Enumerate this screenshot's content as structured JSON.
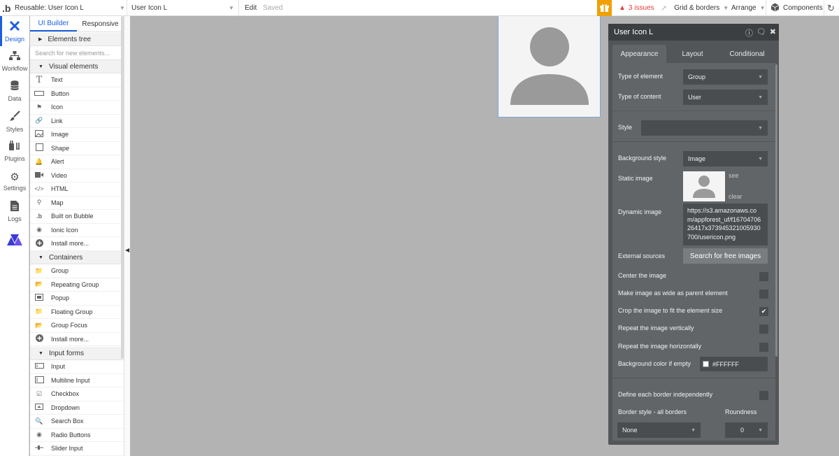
{
  "topbar": {
    "logo": ".b",
    "page_dropdown": "Reusable: User Icon L",
    "element_dropdown": "User Icon L",
    "edit_label": "Edit",
    "saved_label": "Saved",
    "issues_label": "3 issues",
    "grid_label": "Grid & borders",
    "arrange_label": "Arrange",
    "components_label": "Components"
  },
  "rail": {
    "items": [
      {
        "label": "Design",
        "icon": "design-icon"
      },
      {
        "label": "Workflow",
        "icon": "workflow-icon"
      },
      {
        "label": "Data",
        "icon": "database-icon"
      },
      {
        "label": "Styles",
        "icon": "brush-icon"
      },
      {
        "label": "Plugins",
        "icon": "plug-icon"
      },
      {
        "label": "Settings",
        "icon": "gear-icon"
      },
      {
        "label": "Logs",
        "icon": "document-icon"
      }
    ]
  },
  "builder": {
    "tabs": [
      "UI Builder",
      "Responsive"
    ],
    "elements_tree": "Elements tree",
    "search_placeholder": "Search for new elements...",
    "visual_elements": "Visual elements",
    "visual_items": [
      "Text",
      "Button",
      "Icon",
      "Link",
      "Image",
      "Shape",
      "Alert",
      "Video",
      "HTML",
      "Map",
      "Built on Bubble",
      "Ionic Icon",
      "Install more..."
    ],
    "containers": "Containers",
    "container_items": [
      "Group",
      "Repeating Group",
      "Popup",
      "Floating Group",
      "Group Focus",
      "Install more..."
    ],
    "input_forms": "Input forms",
    "input_items": [
      "Input",
      "Multiline Input",
      "Checkbox",
      "Dropdown",
      "Search Box",
      "Radio Buttons",
      "Slider Input"
    ]
  },
  "editor": {
    "title": "User Icon L",
    "tabs": [
      "Appearance",
      "Layout",
      "Conditional"
    ],
    "type_of_element_label": "Type of element",
    "type_of_element_value": "Group",
    "type_of_content_label": "Type of content",
    "type_of_content_value": "User",
    "style_label": "Style",
    "style_value": "",
    "background_style_label": "Background style",
    "background_style_value": "Image",
    "static_image_label": "Static image",
    "see_label": "see",
    "clear_label": "clear",
    "dynamic_image_label": "Dynamic image",
    "dynamic_image_value": "https://s3.amazonaws.com/appforest_uf/f1670470626417x373945321005930700/usericon.png",
    "external_sources_label": "External sources",
    "search_free_images": "Search for free images",
    "center_image_label": "Center the image",
    "center_image_checked": false,
    "wide_as_parent_label": "Make image as wide as parent element",
    "wide_as_parent_checked": false,
    "crop_label": "Crop the image to fit the element size",
    "crop_checked": true,
    "repeat_vertical_label": "Repeat the image vertically",
    "repeat_vertical_checked": false,
    "repeat_horizontal_label": "Repeat the image horizontally",
    "repeat_horizontal_checked": false,
    "bg_color_label": "Background color if empty",
    "bg_color_value": "#FFFFFF",
    "define_borders_label": "Define each border independently",
    "define_borders_checked": false,
    "border_style_label": "Border style - all borders",
    "border_style_value": "None",
    "roundness_label": "Roundness",
    "roundness_value": "0"
  },
  "colors": {
    "accent": "#1b5fe0",
    "issues": "#e8393b",
    "gift": "#f0a000",
    "canvas": "#b3b3b3",
    "editor_bg": "#535659"
  }
}
